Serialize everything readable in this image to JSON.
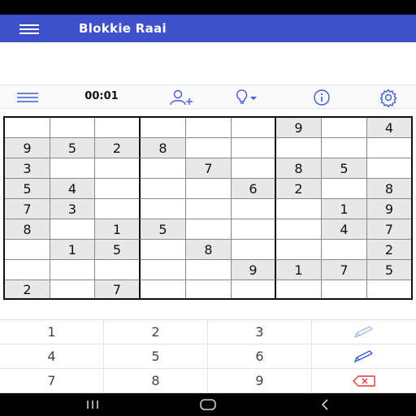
{
  "app": {
    "title": "Blokkie Raai"
  },
  "toolbar": {
    "timer": "00:01"
  },
  "board": {
    "cells": [
      [
        "",
        "",
        "",
        "",
        "",
        "",
        "9",
        "",
        "4"
      ],
      [
        "9",
        "5",
        "2",
        "8",
        "",
        "",
        "",
        "",
        ""
      ],
      [
        "3",
        "",
        "",
        "",
        "7",
        "",
        "8",
        "5",
        ""
      ],
      [
        "5",
        "4",
        "",
        "",
        "",
        "6",
        "2",
        "",
        "8"
      ],
      [
        "7",
        "3",
        "",
        "",
        "",
        "",
        "",
        "1",
        "9"
      ],
      [
        "8",
        "",
        "1",
        "5",
        "",
        "",
        "",
        "4",
        "7"
      ],
      [
        "",
        "1",
        "5",
        "",
        "8",
        "",
        "",
        "",
        "2"
      ],
      [
        "",
        "",
        "",
        "",
        "",
        "9",
        "1",
        "7",
        "5"
      ],
      [
        "2",
        "",
        "7",
        "",
        "",
        "",
        "",
        "",
        ""
      ]
    ]
  },
  "keypad": {
    "digits": [
      "1",
      "2",
      "3",
      "4",
      "5",
      "6",
      "7",
      "8",
      "9"
    ]
  },
  "colors": {
    "app_bar": "#3f51c8",
    "icon_blue": "#3d5bd6",
    "given_cell": "#e8e8e8",
    "erase_red": "#e53935"
  }
}
